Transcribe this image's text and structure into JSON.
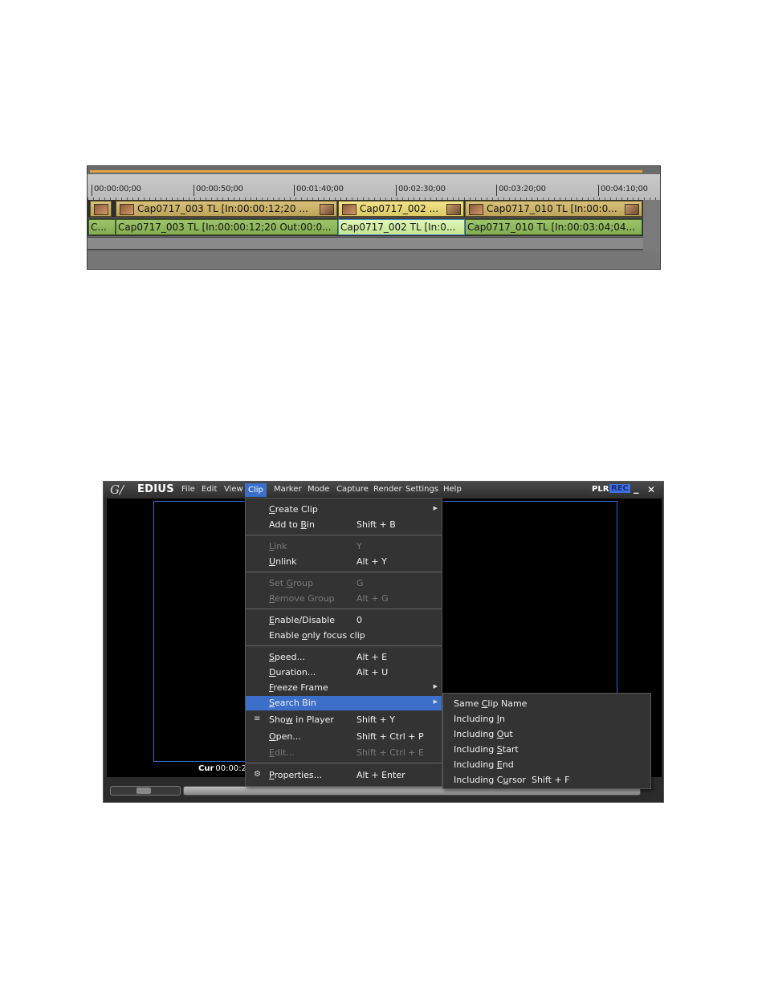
{
  "timeline": {
    "ruler": [
      "00:00:00;00",
      "00:00:50;00",
      "00:01:40;00",
      "00:02:30;00",
      "00:03:20;00",
      "00:04:10;00"
    ],
    "video_clips": [
      {
        "label": "Cap0717_003  TL [In:00:00:12;20 ..."
      },
      {
        "label": "Cap0717_002  ..."
      },
      {
        "label": "Cap0717_010  TL [In:00:0..."
      }
    ],
    "audio_clips": [
      {
        "label": "C..."
      },
      {
        "label": "Cap0717_003  TL [In:00:00:12;20 Out:00:0..."
      },
      {
        "label": "Cap0717_002  TL [In:0..."
      },
      {
        "label": "Cap0717_010  TL [In:00:03:04;04..."
      }
    ]
  },
  "window": {
    "logo": "G∕",
    "app_name": "EDIUS",
    "menu": [
      "File",
      "Edit",
      "View",
      "Clip",
      "Marker",
      "Mode",
      "Capture",
      "Render",
      "Settings",
      "Help"
    ],
    "plr": "PLR",
    "rec": "REC",
    "minimize": "_",
    "close": "✕",
    "cur_label": "Cur",
    "cur_value": "00:00:2"
  },
  "clip_menu": {
    "create_clip": {
      "pre": "",
      "u": "C",
      "post": "reate Clip"
    },
    "add_to_bin": {
      "pre": "Add to ",
      "u": "B",
      "post": "in",
      "shortcut": "Shift + B"
    },
    "link": {
      "pre": "",
      "u": "L",
      "post": "ink",
      "shortcut": "Y"
    },
    "unlink": {
      "pre": "",
      "u": "U",
      "post": "nlink",
      "shortcut": "Alt + Y"
    },
    "set_group": {
      "pre": "Set ",
      "u": "G",
      "post": "roup",
      "shortcut": "G"
    },
    "remove_group": {
      "pre": "",
      "u": "R",
      "post": "emove Group",
      "shortcut": "Alt + G"
    },
    "enable_disable": {
      "pre": "",
      "u": "E",
      "post": "nable/Disable",
      "shortcut": "0"
    },
    "enable_focus": {
      "pre": "Enable ",
      "u": "o",
      "post": "nly focus clip"
    },
    "speed": {
      "pre": "",
      "u": "S",
      "post": "peed...",
      "shortcut": "Alt + E"
    },
    "duration": {
      "pre": "",
      "u": "D",
      "post": "uration...",
      "shortcut": "Alt + U"
    },
    "freeze_frame": {
      "pre": "",
      "u": "F",
      "post": "reeze Frame"
    },
    "search_bin": {
      "pre": "",
      "u": "S",
      "post": "earch Bin"
    },
    "show_in_player": {
      "pre": "Sho",
      "u": "w",
      "post": " in Player",
      "shortcut": "Shift + Y"
    },
    "open": {
      "pre": "",
      "u": "O",
      "post": "pen...",
      "shortcut": "Shift + Ctrl + P"
    },
    "edit": {
      "pre": "",
      "u": "E",
      "post": "dit...",
      "shortcut": "Shift + Ctrl + E"
    },
    "properties": {
      "pre": "",
      "u": "P",
      "post": "roperties...",
      "shortcut": "Alt + Enter"
    }
  },
  "search_bin_submenu": {
    "same_clip_name": {
      "pre": "Same ",
      "u": "C",
      "post": "lip Name"
    },
    "including_in": {
      "pre": "Including ",
      "u": "I",
      "post": "n"
    },
    "including_out": {
      "pre": "Including ",
      "u": "O",
      "post": "ut"
    },
    "including_start": {
      "pre": "Including ",
      "u": "S",
      "post": "tart"
    },
    "including_end": {
      "pre": "Including ",
      "u": "E",
      "post": "nd"
    },
    "including_cursor": {
      "pre": "Including C",
      "u": "u",
      "post": "rsor",
      "shortcut": "Shift + F"
    }
  }
}
